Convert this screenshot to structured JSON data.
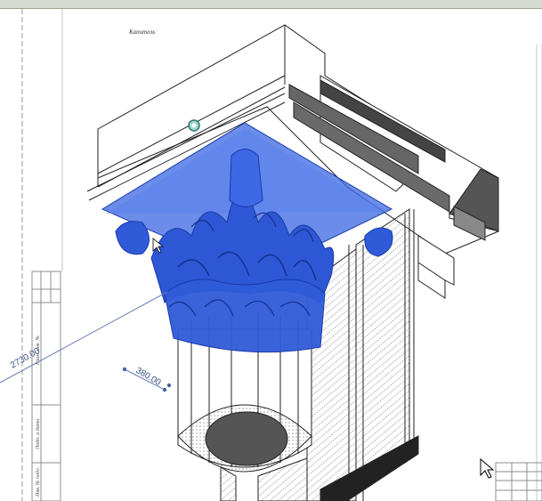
{
  "view": {
    "title_note": "Капитель",
    "dimension_main": "2730.00",
    "dimension_small": "380.00",
    "sheet_labels": [
      "Взам. инв. №",
      "Подп. и дата",
      "Инв. № подл."
    ]
  },
  "colors": {
    "selection": "#2f5bd8",
    "dimension": "#4c62a0",
    "hatch": "#8a8a8a",
    "frame": "#bdbdbd",
    "toolbar": "#d6dbd2"
  },
  "icons": [
    "mouse-cursor-icon",
    "cursor-pointer-icon",
    "control-grip-icon"
  ]
}
